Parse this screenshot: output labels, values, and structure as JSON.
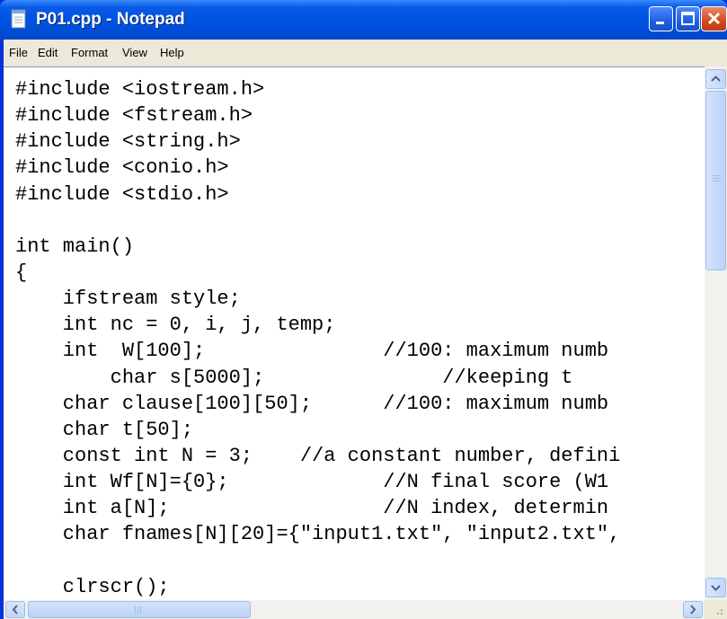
{
  "window": {
    "title": "P01.cpp - Notepad",
    "icon": "notepad-icon",
    "controls": [
      "minimize-icon",
      "maximize-icon",
      "close-icon"
    ],
    "colors": {
      "titlebar": "#0054e3",
      "close_button": "#d24a1e",
      "menubar": "#ece9d8"
    }
  },
  "menu": {
    "file": "File",
    "edit": "Edit",
    "format": "Format",
    "view": "View",
    "help": "Help"
  },
  "editor": {
    "lines": [
      "#include <iostream.h>",
      "#include <fstream.h>",
      "#include <string.h>",
      "#include <conio.h>",
      "#include <stdio.h>",
      "",
      "int main()",
      "{",
      "    ifstream style;",
      "    int nc = 0, i, j, temp;",
      "    int  W[100];               //100: maximum numb",
      "        char s[5000];               //keeping t",
      "    char clause[100][50];      //100: maximum numb",
      "    char t[50];",
      "    const int N = 3;    //a constant number, defini",
      "    int Wf[N]={0};             //N final score (W1",
      "    int a[N];                  //N index, determin",
      "    char fnames[N][20]={\"input1.txt\", \"input2.txt\",",
      "",
      "    clrscr();"
    ]
  },
  "scrollbars": {
    "vertical_position": 0.0,
    "horizontal_position": 0.0,
    "icons": [
      "scroll-up-icon",
      "scroll-down-icon",
      "scroll-left-icon",
      "scroll-right-icon"
    ]
  }
}
